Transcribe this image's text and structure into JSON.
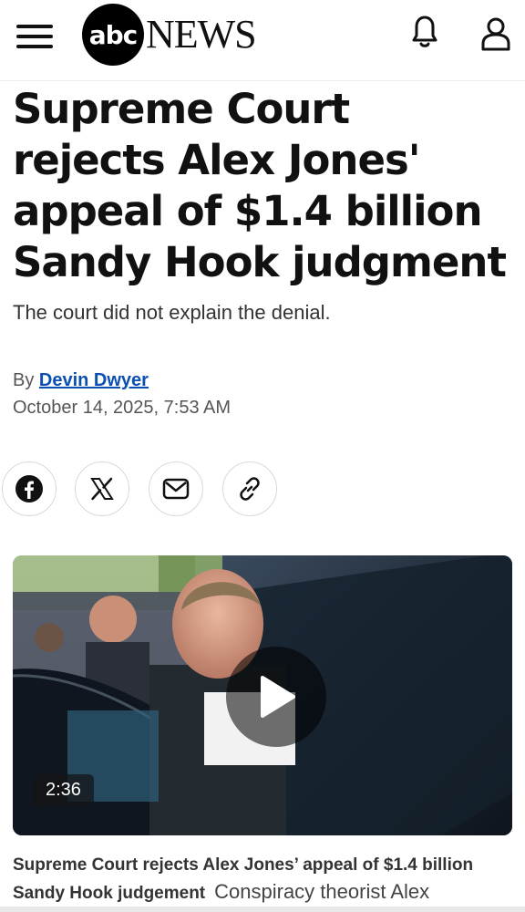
{
  "header": {
    "logo_abc": "abc",
    "logo_news": "NEWS",
    "menu_icon": "hamburger-menu-icon",
    "notifications_icon": "bell-icon",
    "account_icon": "user-icon"
  },
  "article": {
    "headline": "Supreme Court rejects Alex Jones' appeal of $1.4 billion Sandy Hook judgment",
    "subheadline": "The court did not explain the denial.",
    "byline_prefix": "By",
    "author": "Devin Dwyer",
    "date": "October 14, 2025, 7:53 AM"
  },
  "share": {
    "icons": [
      "facebook-icon",
      "x-icon",
      "email-icon",
      "link-icon"
    ]
  },
  "video": {
    "duration": "2:36",
    "caption_title": "Supreme Court rejects Alex Jones’ appeal of $1.4 billion Sandy Hook judgement",
    "caption_text": "Conspiracy theorist Alex"
  },
  "colors": {
    "link": "#0b4fb3",
    "text": "#111111",
    "muted": "#555555"
  }
}
